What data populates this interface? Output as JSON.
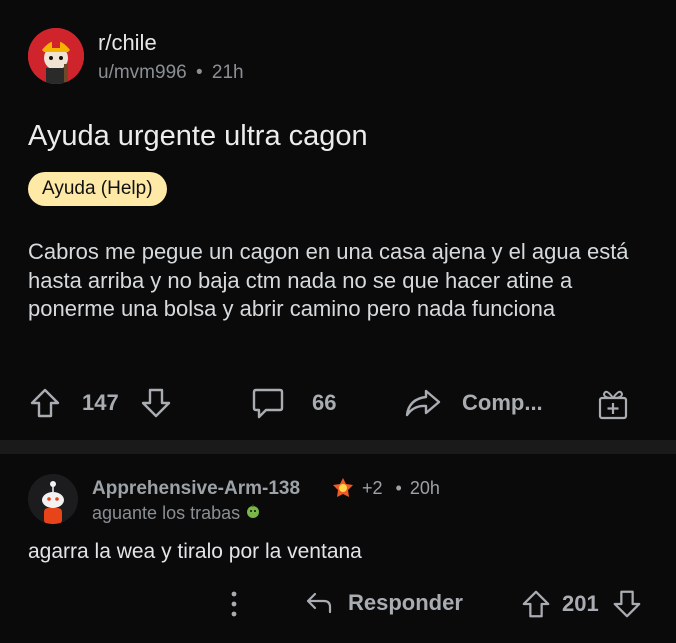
{
  "post": {
    "subreddit": "r/chile",
    "user": "u/mvm996",
    "separator": "•",
    "age": "21h",
    "title": "Ayuda urgente ultra cagon",
    "flair": "Ayuda (Help)",
    "body": "Cabros me pegue un cagon en una casa ajena y el agua está hasta arriba y no baja ctm nada no se que hacer atine a ponerme una bolsa y abrir camino pero nada funciona",
    "upvotes": "147",
    "comments": "66",
    "share_label": "Comp...",
    "icons": [
      "upvote-icon",
      "downvote-icon",
      "comment-icon",
      "share-icon",
      "gift-icon"
    ]
  },
  "comment": {
    "author": "Apprehensive-Arm-138",
    "karma_badge": "+2",
    "separator": "•",
    "age": "20h",
    "flair_text": "aguante los trabas",
    "body": "agarra la wea y tiralo por la ventana",
    "reply_label": "Responder",
    "score": "201",
    "icons": [
      "more-icon",
      "reply-icon",
      "upvote-icon",
      "downvote-icon"
    ]
  },
  "colors": {
    "background": "#0a0a0b",
    "divider": "#1a1a1b",
    "flair_bg": "#ffe9a6",
    "subreddit_avatar": "#d0242d"
  }
}
